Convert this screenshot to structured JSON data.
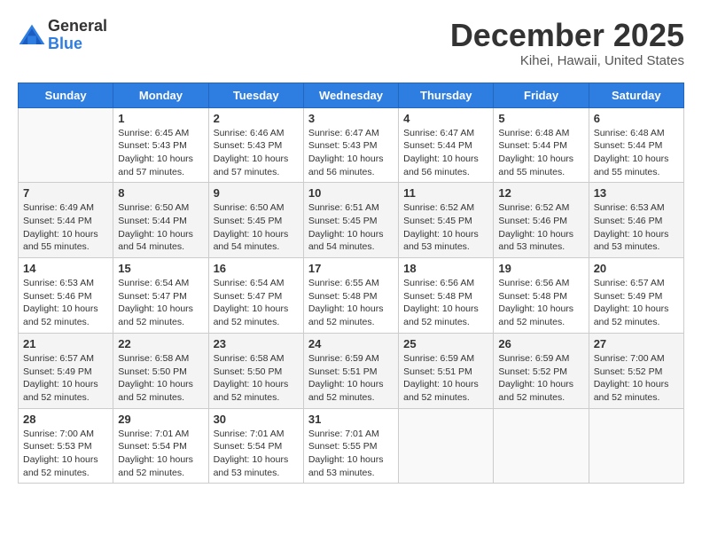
{
  "logo": {
    "general": "General",
    "blue": "Blue"
  },
  "title": "December 2025",
  "location": "Kihei, Hawaii, United States",
  "days_of_week": [
    "Sunday",
    "Monday",
    "Tuesday",
    "Wednesday",
    "Thursday",
    "Friday",
    "Saturday"
  ],
  "weeks": [
    [
      {
        "day": "",
        "info": ""
      },
      {
        "day": "1",
        "info": "Sunrise: 6:45 AM\nSunset: 5:43 PM\nDaylight: 10 hours\nand 57 minutes."
      },
      {
        "day": "2",
        "info": "Sunrise: 6:46 AM\nSunset: 5:43 PM\nDaylight: 10 hours\nand 57 minutes."
      },
      {
        "day": "3",
        "info": "Sunrise: 6:47 AM\nSunset: 5:43 PM\nDaylight: 10 hours\nand 56 minutes."
      },
      {
        "day": "4",
        "info": "Sunrise: 6:47 AM\nSunset: 5:44 PM\nDaylight: 10 hours\nand 56 minutes."
      },
      {
        "day": "5",
        "info": "Sunrise: 6:48 AM\nSunset: 5:44 PM\nDaylight: 10 hours\nand 55 minutes."
      },
      {
        "day": "6",
        "info": "Sunrise: 6:48 AM\nSunset: 5:44 PM\nDaylight: 10 hours\nand 55 minutes."
      }
    ],
    [
      {
        "day": "7",
        "info": "Sunrise: 6:49 AM\nSunset: 5:44 PM\nDaylight: 10 hours\nand 55 minutes."
      },
      {
        "day": "8",
        "info": "Sunrise: 6:50 AM\nSunset: 5:44 PM\nDaylight: 10 hours\nand 54 minutes."
      },
      {
        "day": "9",
        "info": "Sunrise: 6:50 AM\nSunset: 5:45 PM\nDaylight: 10 hours\nand 54 minutes."
      },
      {
        "day": "10",
        "info": "Sunrise: 6:51 AM\nSunset: 5:45 PM\nDaylight: 10 hours\nand 54 minutes."
      },
      {
        "day": "11",
        "info": "Sunrise: 6:52 AM\nSunset: 5:45 PM\nDaylight: 10 hours\nand 53 minutes."
      },
      {
        "day": "12",
        "info": "Sunrise: 6:52 AM\nSunset: 5:46 PM\nDaylight: 10 hours\nand 53 minutes."
      },
      {
        "day": "13",
        "info": "Sunrise: 6:53 AM\nSunset: 5:46 PM\nDaylight: 10 hours\nand 53 minutes."
      }
    ],
    [
      {
        "day": "14",
        "info": "Sunrise: 6:53 AM\nSunset: 5:46 PM\nDaylight: 10 hours\nand 52 minutes."
      },
      {
        "day": "15",
        "info": "Sunrise: 6:54 AM\nSunset: 5:47 PM\nDaylight: 10 hours\nand 52 minutes."
      },
      {
        "day": "16",
        "info": "Sunrise: 6:54 AM\nSunset: 5:47 PM\nDaylight: 10 hours\nand 52 minutes."
      },
      {
        "day": "17",
        "info": "Sunrise: 6:55 AM\nSunset: 5:48 PM\nDaylight: 10 hours\nand 52 minutes."
      },
      {
        "day": "18",
        "info": "Sunrise: 6:56 AM\nSunset: 5:48 PM\nDaylight: 10 hours\nand 52 minutes."
      },
      {
        "day": "19",
        "info": "Sunrise: 6:56 AM\nSunset: 5:48 PM\nDaylight: 10 hours\nand 52 minutes."
      },
      {
        "day": "20",
        "info": "Sunrise: 6:57 AM\nSunset: 5:49 PM\nDaylight: 10 hours\nand 52 minutes."
      }
    ],
    [
      {
        "day": "21",
        "info": "Sunrise: 6:57 AM\nSunset: 5:49 PM\nDaylight: 10 hours\nand 52 minutes."
      },
      {
        "day": "22",
        "info": "Sunrise: 6:58 AM\nSunset: 5:50 PM\nDaylight: 10 hours\nand 52 minutes."
      },
      {
        "day": "23",
        "info": "Sunrise: 6:58 AM\nSunset: 5:50 PM\nDaylight: 10 hours\nand 52 minutes."
      },
      {
        "day": "24",
        "info": "Sunrise: 6:59 AM\nSunset: 5:51 PM\nDaylight: 10 hours\nand 52 minutes."
      },
      {
        "day": "25",
        "info": "Sunrise: 6:59 AM\nSunset: 5:51 PM\nDaylight: 10 hours\nand 52 minutes."
      },
      {
        "day": "26",
        "info": "Sunrise: 6:59 AM\nSunset: 5:52 PM\nDaylight: 10 hours\nand 52 minutes."
      },
      {
        "day": "27",
        "info": "Sunrise: 7:00 AM\nSunset: 5:52 PM\nDaylight: 10 hours\nand 52 minutes."
      }
    ],
    [
      {
        "day": "28",
        "info": "Sunrise: 7:00 AM\nSunset: 5:53 PM\nDaylight: 10 hours\nand 52 minutes."
      },
      {
        "day": "29",
        "info": "Sunrise: 7:01 AM\nSunset: 5:54 PM\nDaylight: 10 hours\nand 52 minutes."
      },
      {
        "day": "30",
        "info": "Sunrise: 7:01 AM\nSunset: 5:54 PM\nDaylight: 10 hours\nand 53 minutes."
      },
      {
        "day": "31",
        "info": "Sunrise: 7:01 AM\nSunset: 5:55 PM\nDaylight: 10 hours\nand 53 minutes."
      },
      {
        "day": "",
        "info": ""
      },
      {
        "day": "",
        "info": ""
      },
      {
        "day": "",
        "info": ""
      }
    ]
  ]
}
